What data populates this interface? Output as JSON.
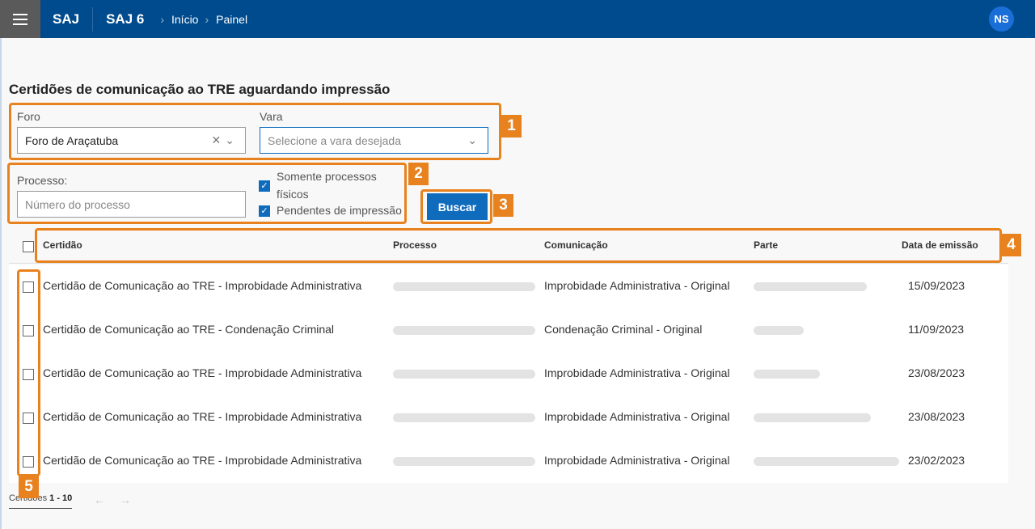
{
  "topbar": {
    "brand": "SAJ",
    "product": "SAJ 6",
    "breadcrumb": [
      "Início",
      "Painel"
    ],
    "avatar_initials": "NS",
    "color": "#004b8d"
  },
  "page_title": "Certidões de comunicação ao TRE aguardando impressão",
  "filters": {
    "foro_label": "Foro",
    "foro_value": "Foro de Araçatuba",
    "vara_label": "Vara",
    "vara_placeholder": "Selecione a vara desejada",
    "processo_label": "Processo:",
    "processo_placeholder": "Número do processo",
    "check_fisicos_line1": "Somente processos",
    "check_fisicos_line2": "físicos",
    "check_pendentes": "Pendentes de impressão",
    "search_button": "Buscar"
  },
  "table": {
    "columns": [
      "Certidão",
      "Processo",
      "Comunicação",
      "Parte",
      "Data de emissão"
    ],
    "rows": [
      {
        "certidao": "Certidão de Comunicação ao TRE - Improbidade Administrativa",
        "comunicacao": "Improbidade Administrativa - Original",
        "data": "15/09/2023"
      },
      {
        "certidao": "Certidão de Comunicação ao TRE - Condenação Criminal",
        "comunicacao": "Condenação Criminal - Original",
        "data": "11/09/2023"
      },
      {
        "certidao": "Certidão de Comunicação ao TRE - Improbidade Administrativa",
        "comunicacao": "Improbidade Administrativa - Original",
        "data": "23/08/2023"
      },
      {
        "certidao": "Certidão de Comunicação ao TRE - Improbidade Administrativa",
        "comunicacao": "Improbidade Administrativa - Original",
        "data": "23/08/2023"
      },
      {
        "certidao": "Certidão de Comunicação ao TRE - Improbidade Administrativa",
        "comunicacao": "Improbidade Administrativa - Original",
        "data": "23/02/2023"
      }
    ]
  },
  "pager": {
    "label": "Certidões",
    "range": "1 - 10"
  },
  "annotations": {
    "color": "#e8821e",
    "labels": [
      "1",
      "2",
      "3",
      "4",
      "5"
    ]
  }
}
